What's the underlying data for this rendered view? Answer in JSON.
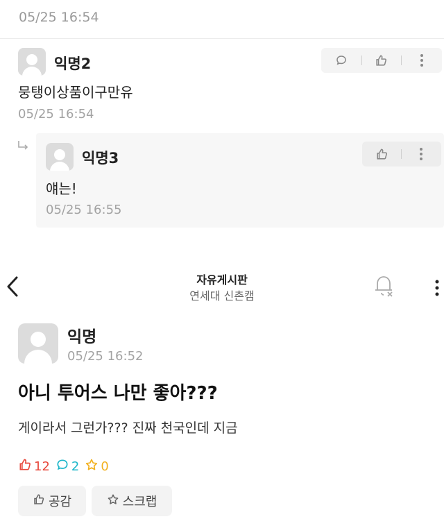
{
  "comments": [
    {
      "time": "05/25 16:54"
    },
    {
      "nick": "익명2",
      "text": "뭉탱이상품이구만유",
      "time": "05/25 16:54"
    }
  ],
  "reply": {
    "nick": "익명3",
    "text": "얘는!",
    "time": "05/25 16:55"
  },
  "header": {
    "title": "자유게시판",
    "subtitle": "연세대 신촌캠"
  },
  "post": {
    "author": "익명",
    "time": "05/25 16:52",
    "title": "아니 투어스 나만 좋아???",
    "body": "게이라서 그런가??? 진짜 천국인데 지금",
    "likes": "12",
    "comments": "2",
    "scraps": "0"
  },
  "buttons": {
    "like_label": "공감",
    "scrap_label": "스크랩"
  },
  "colors": {
    "like": "#e8483c",
    "comment": "#1bb6c9",
    "scrap": "#f2b01e",
    "meta": "#a3a3a3"
  },
  "icons": [
    "comment-icon",
    "thumbs-up-icon",
    "more-vertical-icon",
    "reply-arrow-icon",
    "back-chevron-icon",
    "bell-off-icon",
    "star-icon"
  ]
}
